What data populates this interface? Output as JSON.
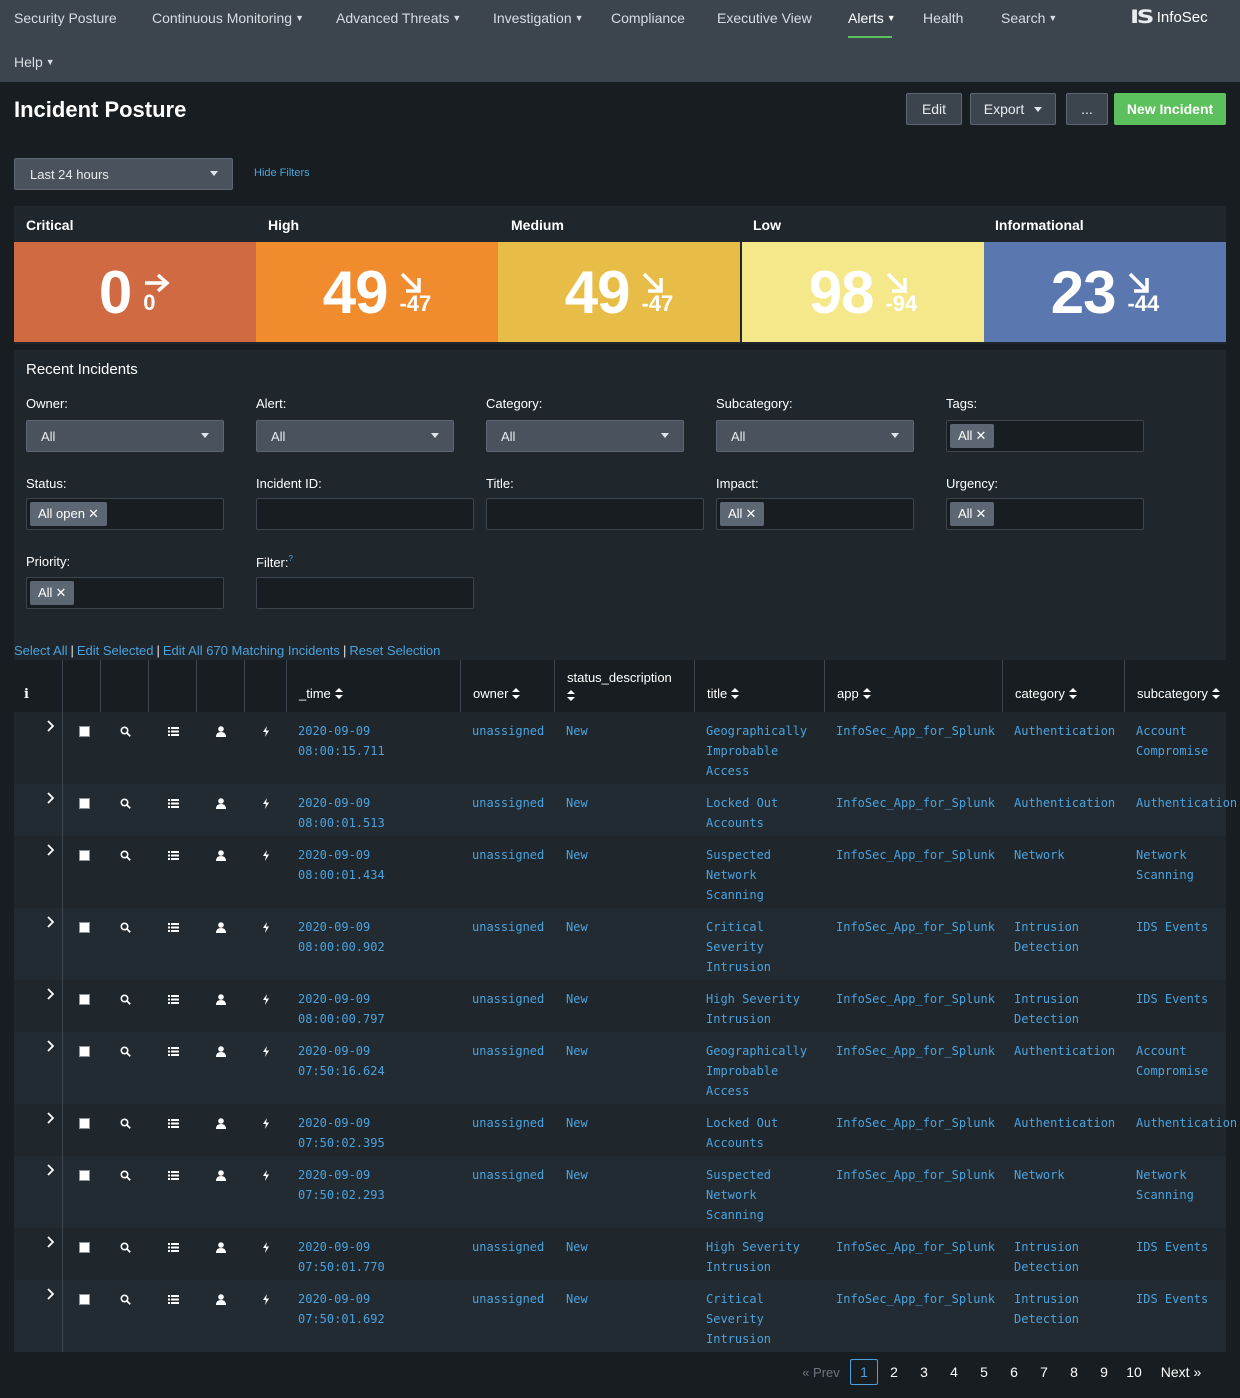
{
  "nav": {
    "items": [
      {
        "label": "Security Posture",
        "caret": false,
        "active": false
      },
      {
        "label": "Continuous Monitoring",
        "caret": true,
        "active": false
      },
      {
        "label": "Advanced Threats",
        "caret": true,
        "active": false
      },
      {
        "label": "Investigation",
        "caret": true,
        "active": false
      },
      {
        "label": "Compliance",
        "caret": false,
        "active": false
      },
      {
        "label": "Executive View",
        "caret": false,
        "active": false
      },
      {
        "label": "Alerts",
        "caret": true,
        "active": true
      },
      {
        "label": "Health",
        "caret": false,
        "active": false
      },
      {
        "label": "Search",
        "caret": true,
        "active": false
      },
      {
        "label": "Help",
        "caret": true,
        "active": false
      }
    ],
    "logo_mark": "IS",
    "logo_text": "InfoSec"
  },
  "header": {
    "title": "Incident Posture",
    "edit_label": "Edit",
    "export_label": "Export",
    "more_label": "...",
    "new_incident_label": "New Incident"
  },
  "time_picker": {
    "value": "Last 24 hours"
  },
  "hide_filters_label": "Hide Filters",
  "severity": [
    {
      "label": "Critical",
      "value": "0",
      "delta": "0",
      "trend": "flat",
      "color": "#d06a43"
    },
    {
      "label": "High",
      "value": "49",
      "delta": "-47",
      "trend": "down",
      "color": "#f08c2e"
    },
    {
      "label": "Medium",
      "value": "49",
      "delta": "-47",
      "trend": "down",
      "color": "#e8bd47"
    },
    {
      "label": "Low",
      "value": "98",
      "delta": "-94",
      "trend": "down",
      "color": "#f4e88a"
    },
    {
      "label": "Informational",
      "value": "23",
      "delta": "-44",
      "trend": "down",
      "color": "#5a77b0"
    }
  ],
  "incidents": {
    "title": "Recent Incidents",
    "filters": {
      "owner": {
        "label": "Owner:",
        "value": "All"
      },
      "alert": {
        "label": "Alert:",
        "value": "All"
      },
      "category": {
        "label": "Category:",
        "value": "All"
      },
      "subcategory": {
        "label": "Subcategory:",
        "value": "All"
      },
      "tags": {
        "label": "Tags:",
        "token": "All"
      },
      "status": {
        "label": "Status:",
        "token": "All open"
      },
      "incident_id": {
        "label": "Incident ID:",
        "value": ""
      },
      "title": {
        "label": "Title:",
        "value": ""
      },
      "impact": {
        "label": "Impact:",
        "token": "All"
      },
      "urgency": {
        "label": "Urgency:",
        "token": "All"
      },
      "priority": {
        "label": "Priority:",
        "token": "All"
      },
      "filter": {
        "label": "Filter:",
        "help": "?",
        "value": ""
      }
    },
    "bulk_actions": {
      "select_all": "Select All",
      "edit_selected": "Edit Selected",
      "edit_all": "Edit All 670 Matching Incidents",
      "reset": "Reset Selection",
      "separator": "|"
    },
    "columns": {
      "info": "i",
      "time": "_time",
      "owner": "owner",
      "status": "status_description",
      "title": "title",
      "app": "app",
      "category": "category",
      "subcategory": "subcategory"
    },
    "rows": [
      {
        "time": [
          "2020-09-09",
          "08:00:15.711"
        ],
        "owner": "unassigned",
        "status": "New",
        "title": [
          "Geographically",
          "Improbable",
          "Access"
        ],
        "app": "InfoSec_App_for_Splunk",
        "category": [
          "Authentication"
        ],
        "subcategory": [
          "Account",
          "Compromise"
        ]
      },
      {
        "time": [
          "2020-09-09",
          "08:00:01.513"
        ],
        "owner": "unassigned",
        "status": "New",
        "title": [
          "Locked Out",
          "Accounts"
        ],
        "app": "InfoSec_App_for_Splunk",
        "category": [
          "Authentication"
        ],
        "subcategory": [
          "Authentication"
        ]
      },
      {
        "time": [
          "2020-09-09",
          "08:00:01.434"
        ],
        "owner": "unassigned",
        "status": "New",
        "title": [
          "Suspected",
          "Network",
          "Scanning"
        ],
        "app": "InfoSec_App_for_Splunk",
        "category": [
          "Network"
        ],
        "subcategory": [
          "Network",
          "Scanning"
        ]
      },
      {
        "time": [
          "2020-09-09",
          "08:00:00.902"
        ],
        "owner": "unassigned",
        "status": "New",
        "title": [
          "Critical",
          "Severity",
          "Intrusion"
        ],
        "app": "InfoSec_App_for_Splunk",
        "category": [
          "Intrusion",
          "Detection"
        ],
        "subcategory": [
          "IDS Events"
        ]
      },
      {
        "time": [
          "2020-09-09",
          "08:00:00.797"
        ],
        "owner": "unassigned",
        "status": "New",
        "title": [
          "High Severity",
          "Intrusion"
        ],
        "app": "InfoSec_App_for_Splunk",
        "category": [
          "Intrusion",
          "Detection"
        ],
        "subcategory": [
          "IDS Events"
        ]
      },
      {
        "time": [
          "2020-09-09",
          "07:50:16.624"
        ],
        "owner": "unassigned",
        "status": "New",
        "title": [
          "Geographically",
          "Improbable",
          "Access"
        ],
        "app": "InfoSec_App_for_Splunk",
        "category": [
          "Authentication"
        ],
        "subcategory": [
          "Account",
          "Compromise"
        ]
      },
      {
        "time": [
          "2020-09-09",
          "07:50:02.395"
        ],
        "owner": "unassigned",
        "status": "New",
        "title": [
          "Locked Out",
          "Accounts"
        ],
        "app": "InfoSec_App_for_Splunk",
        "category": [
          "Authentication"
        ],
        "subcategory": [
          "Authentication"
        ]
      },
      {
        "time": [
          "2020-09-09",
          "07:50:02.293"
        ],
        "owner": "unassigned",
        "status": "New",
        "title": [
          "Suspected",
          "Network",
          "Scanning"
        ],
        "app": "InfoSec_App_for_Splunk",
        "category": [
          "Network"
        ],
        "subcategory": [
          "Network",
          "Scanning"
        ]
      },
      {
        "time": [
          "2020-09-09",
          "07:50:01.770"
        ],
        "owner": "unassigned",
        "status": "New",
        "title": [
          "High Severity",
          "Intrusion"
        ],
        "app": "InfoSec_App_for_Splunk",
        "category": [
          "Intrusion",
          "Detection"
        ],
        "subcategory": [
          "IDS Events"
        ]
      },
      {
        "time": [
          "2020-09-09",
          "07:50:01.692"
        ],
        "owner": "unassigned",
        "status": "New",
        "title": [
          "Critical",
          "Severity",
          "Intrusion"
        ],
        "app": "InfoSec_App_for_Splunk",
        "category": [
          "Intrusion",
          "Detection"
        ],
        "subcategory": [
          "IDS Events"
        ]
      }
    ],
    "row_icons": [
      "chevron-right-icon",
      "checkbox-icon",
      "magnifier-icon",
      "list-icon",
      "user-icon",
      "lightning-icon"
    ],
    "pagination": {
      "prev": "« Prev",
      "next": "Next »",
      "pages": [
        "1",
        "2",
        "3",
        "4",
        "5",
        "6",
        "7",
        "8",
        "9",
        "10"
      ],
      "current": "1"
    }
  }
}
